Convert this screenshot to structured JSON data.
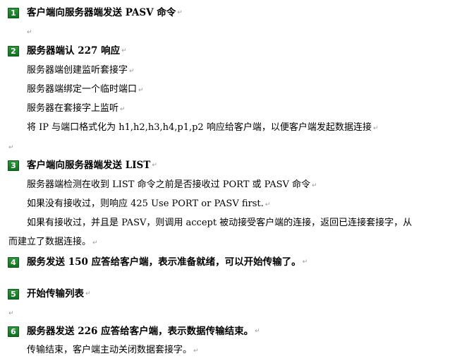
{
  "paragraph_mark": "↵",
  "steps": [
    {
      "number": "1",
      "title": "客户端向服务器端发送 PASV 命令"
    },
    {
      "number": "2",
      "title": "服务器端认 227 响应",
      "lines": [
        "服务器端创建监听套接字",
        "服务器端绑定一个临时端口",
        "服务器在套接字上监听",
        "将 IP 与端口格式化为 h1,h2,h3,h4,p1,p2 响应给客户端，以便客户端发起数据连接"
      ]
    },
    {
      "number": "3",
      "title": "客户端向服务器端发送 LIST",
      "lines": [
        "服务器端检测在收到 LIST 命令之前是否接收过 PORT 或 PASV 命令",
        "如果没有接收过，则响应 425 Use PORT or PASV first.",
        "如果有接收过，并且是 PASV，则调用 accept 被动接受客户端的连接，返回已连接套接字，从",
        "而建立了数据连接。"
      ]
    },
    {
      "number": "4",
      "title": "服务发送 150 应答给客户端，表示准备就绪，可以开始传输了。"
    },
    {
      "number": "5",
      "title": "开始传输列表"
    },
    {
      "number": "6",
      "title": "服务器发送 226 应答给客户端，表示数据传输结束。",
      "lines": [
        "传输结束，客户端主动关闭数据套接字。"
      ]
    }
  ]
}
